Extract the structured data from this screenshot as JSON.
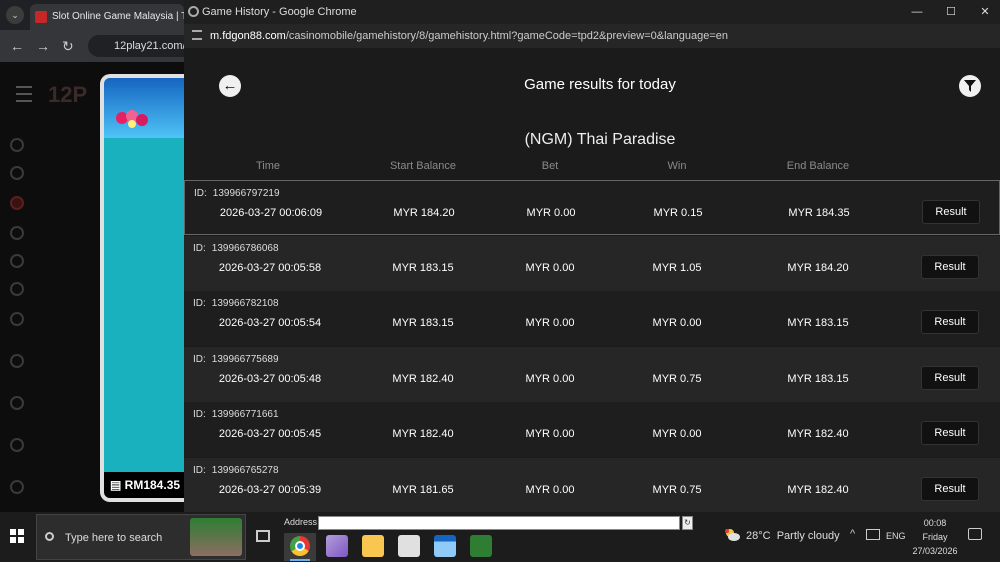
{
  "background_browser": {
    "tab_title": "Slot Online Game Malaysia | Top",
    "tab_logo_text": "12P",
    "url": "12play21.com/",
    "balance": "RM184.35"
  },
  "popup": {
    "window_title": "Game History - Google Chrome",
    "url_host": "m.fdgon88.com",
    "url_path": "/casinomobile/gamehistory/8/gamehistory.html?gameCode=tpd2&preview=0&language=en",
    "page_title": "Game results for today",
    "game_name": "(NGM) Thai Paradise",
    "columns": {
      "time": "Time",
      "start_balance": "Start Balance",
      "bet": "Bet",
      "win": "Win",
      "end_balance": "End Balance"
    },
    "id_prefix": "ID:",
    "result_label": "Result",
    "rows": [
      {
        "id": "139966797219",
        "time": "2026-03-27 00:06:09",
        "start": "MYR 184.20",
        "bet": "MYR 0.00",
        "win": "MYR 0.15",
        "end": "MYR 184.35"
      },
      {
        "id": "139966786068",
        "time": "2026-03-27 00:05:58",
        "start": "MYR 183.15",
        "bet": "MYR 0.00",
        "win": "MYR 1.05",
        "end": "MYR 184.20"
      },
      {
        "id": "139966782108",
        "time": "2026-03-27 00:05:54",
        "start": "MYR 183.15",
        "bet": "MYR 0.00",
        "win": "MYR 0.00",
        "end": "MYR 183.15"
      },
      {
        "id": "139966775689",
        "time": "2026-03-27 00:05:48",
        "start": "MYR 182.40",
        "bet": "MYR 0.00",
        "win": "MYR 0.75",
        "end": "MYR 183.15"
      },
      {
        "id": "139966771661",
        "time": "2026-03-27 00:05:45",
        "start": "MYR 182.40",
        "bet": "MYR 0.00",
        "win": "MYR 0.00",
        "end": "MYR 182.40"
      },
      {
        "id": "139966765278",
        "time": "2026-03-27 00:05:39",
        "start": "MYR 181.65",
        "bet": "MYR 0.00",
        "win": "MYR 0.75",
        "end": "MYR 182.40"
      }
    ]
  },
  "taskbar": {
    "search_placeholder": "Type here to search",
    "address_label": "Address",
    "temperature": "28°C",
    "weather": "Partly cloudy",
    "language": "ENG",
    "time": "00:08",
    "day": "Friday",
    "date": "27/03/2026"
  }
}
